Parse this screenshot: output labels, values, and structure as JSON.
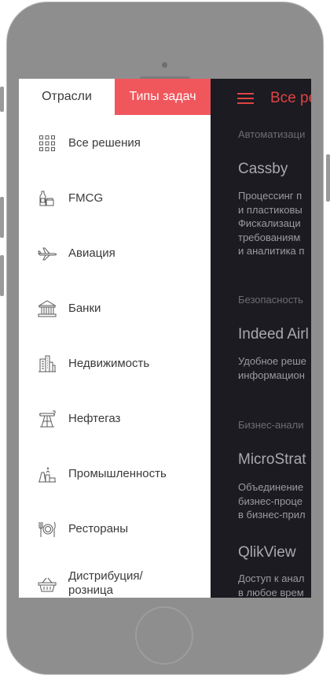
{
  "drawer": {
    "tabs": [
      {
        "label": "Отрасли",
        "active": false
      },
      {
        "label": "Типы задач",
        "active": true
      }
    ],
    "items": [
      {
        "label": "Все решения",
        "icon": "grid-icon"
      },
      {
        "label": "FMCG",
        "icon": "bottle-icon"
      },
      {
        "label": "Авиация",
        "icon": "airplane-icon"
      },
      {
        "label": "Банки",
        "icon": "bank-icon"
      },
      {
        "label": "Недвижимость",
        "icon": "buildings-icon"
      },
      {
        "label": "Нефтегаз",
        "icon": "oil-pump-icon"
      },
      {
        "label": "Промышленность",
        "icon": "factory-icon"
      },
      {
        "label": "Рестораны",
        "icon": "cutlery-icon"
      },
      {
        "label_line1": "Дистрибуция/",
        "label_line2": "розница",
        "icon": "basket-icon"
      }
    ]
  },
  "content": {
    "title": "Все ре",
    "sections": [
      {
        "category": "Автоматизаци",
        "heading": "Cassby",
        "desc": [
          "Процессинг п",
          "и пластиковы",
          "Фискализаци",
          "требованиям",
          "и аналитика п"
        ]
      },
      {
        "category": "Безопасность",
        "heading": "Indeed Airl",
        "desc": [
          "Удобное реше",
          "информацион"
        ]
      },
      {
        "category": "Бизнес-анали",
        "heading": "MicroStrat",
        "desc": [
          "Объединение",
          "бизнес-проце",
          "в бизнес-прил"
        ]
      },
      {
        "category": "",
        "heading": "QlikView",
        "desc": [
          "Доступ к анал",
          "в любое врем"
        ]
      }
    ]
  },
  "colors": {
    "accent": "#f0575c",
    "title_red": "#e04343",
    "dark_bg": "#1b1b21",
    "device": "#8f8f8f"
  }
}
